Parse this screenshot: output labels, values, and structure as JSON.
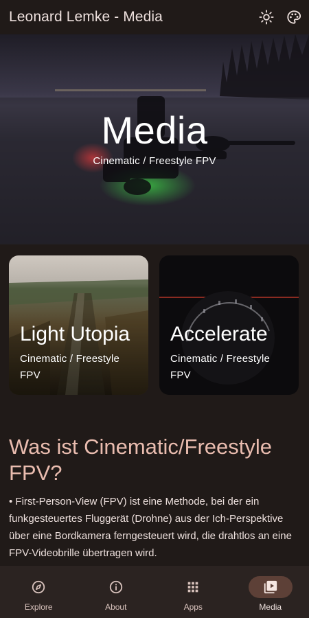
{
  "app_bar": {
    "title": "Leonard Lemke - Media",
    "actions": [
      {
        "icon": "brightness-icon"
      },
      {
        "icon": "palette-icon"
      }
    ]
  },
  "hero": {
    "title": "Media",
    "subtitle": "Cinematic / Freestyle FPV"
  },
  "cards": [
    {
      "title": "Light Utopia",
      "subtitle": "Cinematic / Freestyle FPV"
    },
    {
      "title": "Accelerate",
      "subtitle": "Cinematic / Freestyle FPV"
    }
  ],
  "article": {
    "heading": "Was ist Cinematic/Freestyle FPV?",
    "paragraphs": [
      "• First-Person-View (FPV) ist eine Methode, bei der ein funkgesteuertes Fluggerät (Drohne) aus der Ich-Perspektive über eine Bordkamera ferngesteuert wird, die drahtlos an eine FPV-Videobrille übertragen wird."
    ]
  },
  "bottom_nav": {
    "items": [
      {
        "label": "Explore",
        "icon": "compass-icon",
        "active": false
      },
      {
        "label": "About",
        "icon": "info-icon",
        "active": false
      },
      {
        "label": "Apps",
        "icon": "grid-icon",
        "active": false
      },
      {
        "label": "Media",
        "icon": "video-library-icon",
        "active": true
      }
    ]
  },
  "colors": {
    "background": "#201a18",
    "heading": "#e9bcaf",
    "nav_background": "#2b2321",
    "nav_active": "#5d4037"
  }
}
